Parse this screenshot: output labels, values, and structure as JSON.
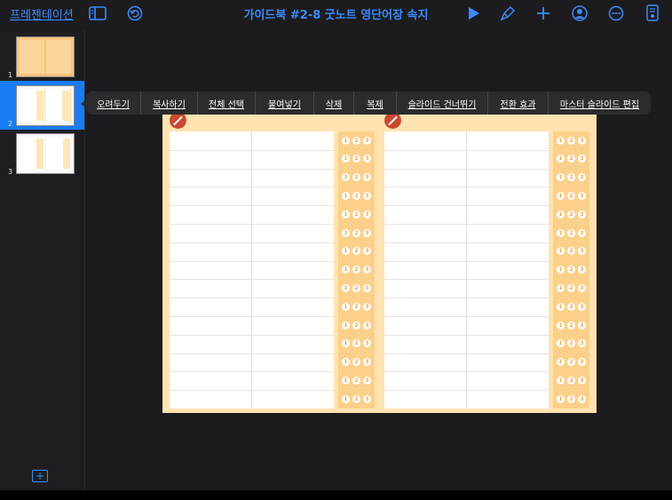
{
  "topbar": {
    "back_label": "프레젠테이션",
    "title": "가이드북 #2-8 굿노트 영단어장 속지",
    "icons": [
      "sidebar-icon",
      "undo-icon",
      "play-icon",
      "paintbrush-icon",
      "plus-icon",
      "collaborate-icon",
      "more-icon",
      "document-icon"
    ]
  },
  "sidebar": {
    "slides": [
      {
        "number": "1",
        "selected": false
      },
      {
        "number": "2",
        "selected": true
      },
      {
        "number": "3",
        "selected": false
      }
    ],
    "add_icon": "add-slide-icon"
  },
  "context_menu": {
    "items": [
      "오려두기",
      "복사하기",
      "전체 선택",
      "붙여넣기",
      "삭제",
      "복제",
      "슬라이드 건너뛰기",
      "전환 효과",
      "마스터 슬라이드 편집"
    ]
  },
  "slide": {
    "rows": 15,
    "number_labels": [
      "1",
      "2",
      "3"
    ],
    "colors": {
      "background": "#ffe3b0",
      "accent": "#fbd08a",
      "badge": "#c94a2f"
    }
  },
  "colors": {
    "accent": "#3b8bff",
    "selection": "#1a7cf5",
    "app_bg": "#1c1c1e"
  }
}
